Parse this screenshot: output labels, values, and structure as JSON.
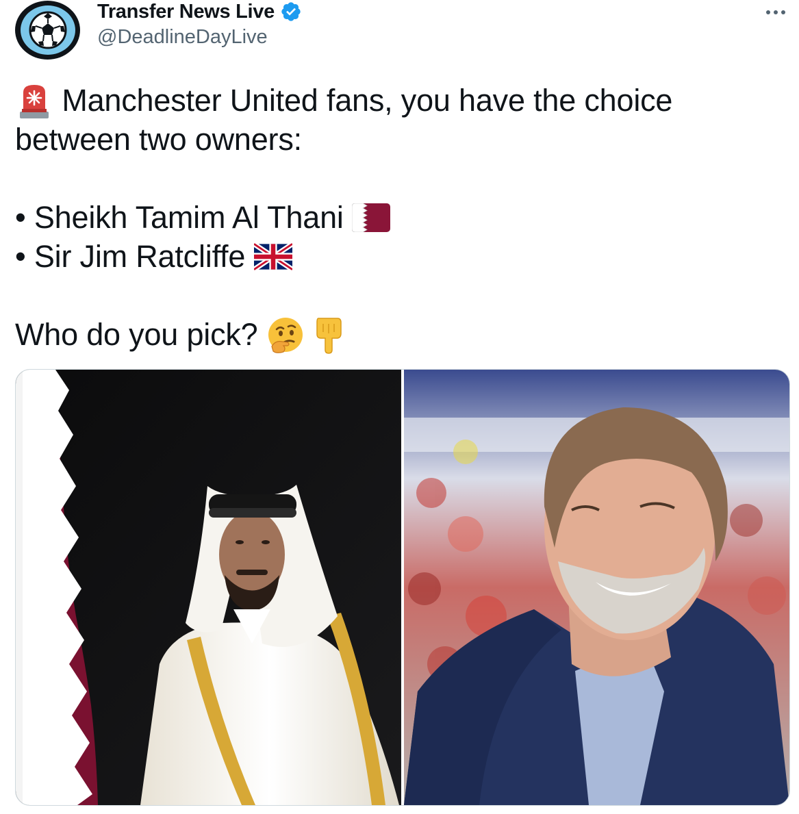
{
  "account": {
    "display_name": "Transfer News Live",
    "handle": "@DeadlineDayLive",
    "avatar_icon": "soccer-ball-icon",
    "verified_icon": "verified-badge-icon"
  },
  "more_icon": "more-options-icon",
  "tweet": {
    "line1_emoji": "rotating-light-emoji",
    "line1": "Manchester United fans, you have the choice",
    "line2": "between two owners:",
    "bullet1": "• Sheikh Tamim Al Thani",
    "bullet1_flag": "qatar-flag-emoji",
    "bullet2": "• Sir Jim Ratcliffe",
    "bullet2_flag": "uk-flag-emoji",
    "question": "Who do you pick?",
    "question_emojis": [
      "thinking-face-emoji",
      "pointing-down-emoji"
    ]
  },
  "media": {
    "left_photo": "photo-sheikh-tamim",
    "right_photo": "photo-jim-ratcliffe"
  },
  "colors": {
    "text": "#0f1419",
    "secondary": "#536471",
    "verified": "#1d9bf0",
    "avatar_bg": "#7cc7ea",
    "qatar_maroon": "#8a1538"
  }
}
